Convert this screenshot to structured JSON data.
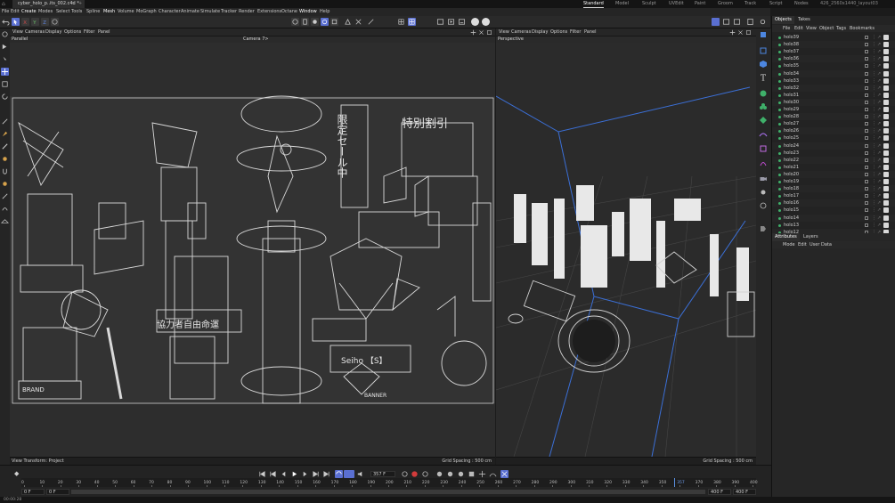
{
  "app": {
    "document_tab": "cyber_holo_p..its_002.c4d *",
    "layout_tabs": [
      "Standard",
      "Model",
      "Sculpt",
      "UVEdit",
      "Paint",
      "Groom",
      "Track",
      "Script",
      "Nodes"
    ],
    "layout_name": "426_2560x1440_layout03"
  },
  "menu": [
    "File",
    "Edit",
    "Create",
    "Modes",
    "Select",
    "Tools",
    "Spline",
    "Mesh",
    "Volume",
    "MoGraph",
    "Character",
    "Animate",
    "Simulate",
    "Tracker",
    "Render",
    "Extensions",
    "Octane",
    "Window",
    "Help"
  ],
  "left_viewport": {
    "menu": [
      "View",
      "Cameras",
      "Display",
      "Options",
      "Filter",
      "Panel"
    ],
    "projection": "Parallel",
    "camera": "Camera 7>",
    "footer_left": "View Transform: Project",
    "footer_right": "Grid Spacing : 500 cm",
    "scene_text": {
      "kanji_a": "限定セール中",
      "kanji_b": "特別割引",
      "kanji_c": "協力者自由命運",
      "sign_seiho": "Seiho 【S】",
      "sign_brand": "BRAND",
      "banner": "BANNER"
    }
  },
  "right_viewport": {
    "menu": [
      "View",
      "Cameras",
      "Display",
      "Options",
      "Filter",
      "Panel"
    ],
    "projection": "Perspective",
    "footer_right": "Grid Spacing : 500 cm"
  },
  "objects_panel": {
    "tabs": [
      "Objects",
      "Takes"
    ],
    "menu": [
      "File",
      "Edit",
      "View",
      "Object",
      "Tags",
      "Bookmarks"
    ],
    "items": [
      "holo39",
      "holo38",
      "holo37",
      "holo36",
      "holo35",
      "holo34",
      "holo33",
      "holo32",
      "holo31",
      "holo30",
      "holo29",
      "holo28",
      "holo27",
      "holo26",
      "holo25",
      "holo24",
      "holo23",
      "holo22",
      "holo21",
      "holo20",
      "holo19",
      "holo18",
      "holo17",
      "holo16",
      "holo15",
      "holo14",
      "holo13",
      "holo12",
      "holo11"
    ]
  },
  "attributes_panel": {
    "tabs": [
      "Attributes",
      "Layers"
    ],
    "menu": [
      "Mode",
      "Edit",
      "User Data"
    ]
  },
  "timeline": {
    "current_frame_field": "357 F",
    "ticks": [
      "0",
      "10",
      "20",
      "30",
      "40",
      "50",
      "60",
      "70",
      "80",
      "90",
      "100",
      "110",
      "120",
      "130",
      "140",
      "150",
      "160",
      "170",
      "180",
      "190",
      "200",
      "210",
      "220",
      "230",
      "240",
      "250",
      "260",
      "270",
      "280",
      "290",
      "300",
      "310",
      "320",
      "330",
      "340",
      "350",
      "357",
      "370",
      "380",
      "390",
      "400"
    ],
    "start_field": "0 F",
    "start_field2": "0 F",
    "end_field": "400 F",
    "end_field2": "400 F"
  },
  "status": "00:00:28"
}
